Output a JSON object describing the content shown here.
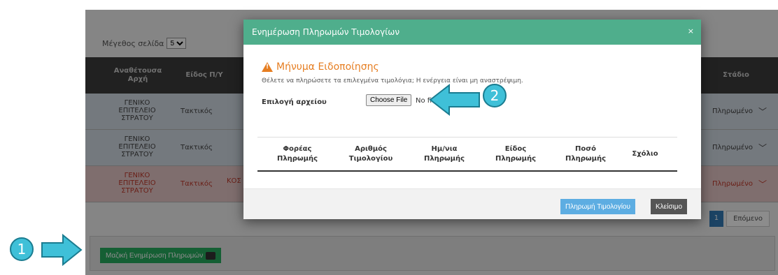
{
  "page_size": {
    "label": "Μέγεθος σελίδα",
    "value": "5"
  },
  "table": {
    "headers": [
      "Αναθέτουσα Αρχή",
      "Είδος Π/Υ",
      "Στάδιο"
    ],
    "rows": [
      {
        "authority": "ΓΕΝΙΚΟ ΕΠΙΤΕΛΕΙΟ ΣΤΡΑΤΟΥ",
        "type": "Τακτικός",
        "extra": "",
        "stage": "Πληρωμένο"
      },
      {
        "authority": "ΓΕΝΙΚΟ ΕΠΙΤΕΛΕΙΟ ΣΤΡΑΤΟΥ",
        "type": "Τακτικός",
        "extra": "",
        "stage": "Πληρωμένο"
      },
      {
        "authority": "ΓΕΝΙΚΟ ΕΠΙΤΕΛΕΙΟ ΣΤΡΑΤΟΥ",
        "type": "Τακτικός",
        "extra": "ΚΟΣ",
        "stage": "Πληρωμένο"
      }
    ]
  },
  "pager": {
    "page": "1",
    "next": "Επόμενο"
  },
  "bulk_button": "Μαζική Ενημέρωση Πληρωμών",
  "modal": {
    "title": "Ενημέρωση Πληρωμών Τιμολογίων",
    "close_x": "×",
    "warning_title": "Μήνυμα Ειδοποίησης",
    "warning_text": "Θέλετε να πληρώσετε τα επιλεγμένα τιμολόγια; Η ενέργεια είναι μη αναστρέψιμη.",
    "file_label": "Επιλογή αρχείου",
    "file_button": "Choose File",
    "file_status": "No fi",
    "columns": [
      "Φορέας Πληρωμής",
      "Αριθμός Τιμολογίου",
      "Ημ/νια Πληρωμής",
      "Είδος Πληρωμής",
      "Ποσό Πληρωμής",
      "Σχόλιο"
    ],
    "pay_button": "Πληρωμή Τιμολογίου",
    "close_button": "Κλείσιμο"
  },
  "annotations": {
    "step1": "1",
    "step2": "2"
  },
  "colors": {
    "header": "#4fae8c",
    "warning": "#e67e22",
    "annotation": "#3fc0d8"
  }
}
